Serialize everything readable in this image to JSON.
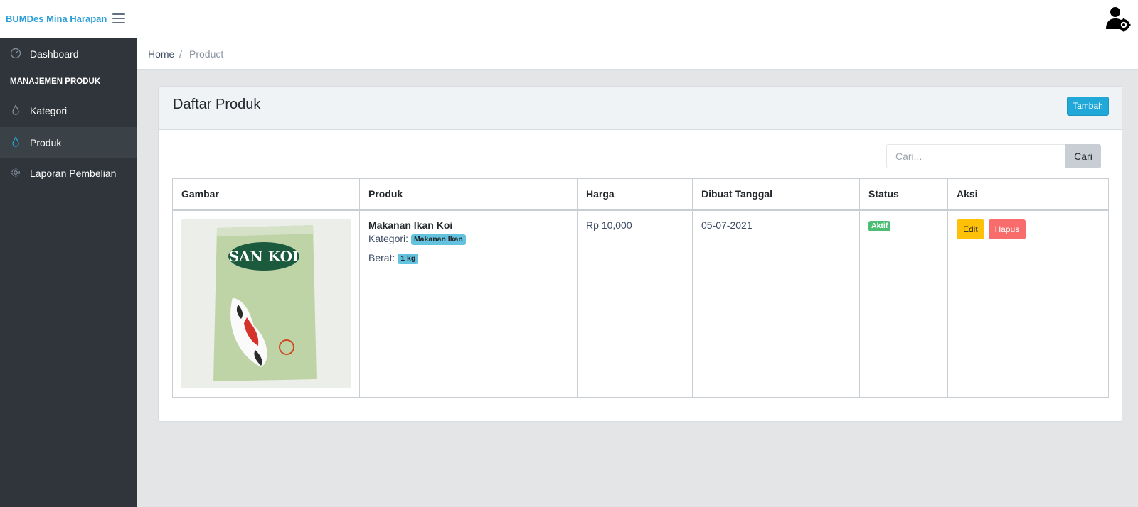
{
  "header": {
    "brand": "BUMDes Mina Harapan",
    "menu_icon": "hamburger-icon",
    "user_icon": "user-settings-icon"
  },
  "sidebar": {
    "items": [
      {
        "label": "Dashboard",
        "icon": "speedometer-icon"
      },
      {
        "label": "Kategori",
        "icon": "drop-icon"
      },
      {
        "label": "Produk",
        "icon": "drop-icon",
        "active": true
      },
      {
        "label": "Laporan Pembelian",
        "icon": "gear-icon"
      }
    ],
    "section_title": "MANAJEMEN PRODUK"
  },
  "breadcrumb": {
    "home": "Home",
    "separator": "/",
    "current": "Product"
  },
  "card": {
    "title": "Daftar Produk",
    "add_button": "Tambah"
  },
  "search": {
    "placeholder": "Cari...",
    "button": "Cari"
  },
  "table": {
    "columns": [
      "Gambar",
      "Produk",
      "Harga",
      "Dibuat Tanggal",
      "Status",
      "Aksi"
    ],
    "rows": [
      {
        "image_brand": "SAN KOI",
        "name": "Makanan Ikan Koi",
        "category_label": "Kategori:",
        "category": "Makanan Ikan",
        "weight_label": "Berat:",
        "weight": "1 kg",
        "price": "Rp 10,000",
        "created": "05-07-2021",
        "status": "Aktif",
        "edit": "Edit",
        "delete": "Hapus"
      }
    ]
  },
  "colors": {
    "brand": "#2a9fd6",
    "sidebar": "#2f353a",
    "primary": "#20a8d8",
    "warning": "#ffc107",
    "danger": "#f86c6b",
    "success": "#4dbd74",
    "info": "#63c2de"
  }
}
